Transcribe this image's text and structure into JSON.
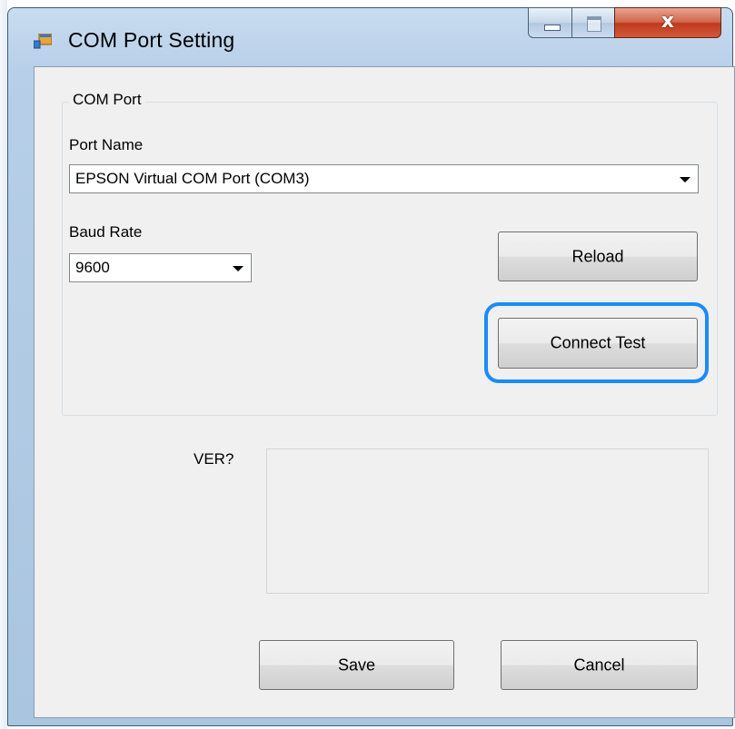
{
  "window": {
    "title": "COM Port Setting",
    "icons": {
      "app": "app-window-icon",
      "minimize": "minimize-icon",
      "maximize": "maximize-icon",
      "close": "close-icon"
    },
    "close_glyph": "x"
  },
  "group": {
    "label": "COM Port",
    "port_name_label": "Port Name",
    "port_name_value": "EPSON Virtual COM Port (COM3)",
    "baud_rate_label": "Baud Rate",
    "baud_rate_value": "9600",
    "reload_label": "Reload",
    "connect_test_label": "Connect Test"
  },
  "ver": {
    "label": "VER?",
    "value": ""
  },
  "footer": {
    "save_label": "Save",
    "cancel_label": "Cancel"
  },
  "colors": {
    "highlight": "#1a8cf5",
    "close_button": "#c0391d",
    "client_bg": "#f0f0f0"
  }
}
